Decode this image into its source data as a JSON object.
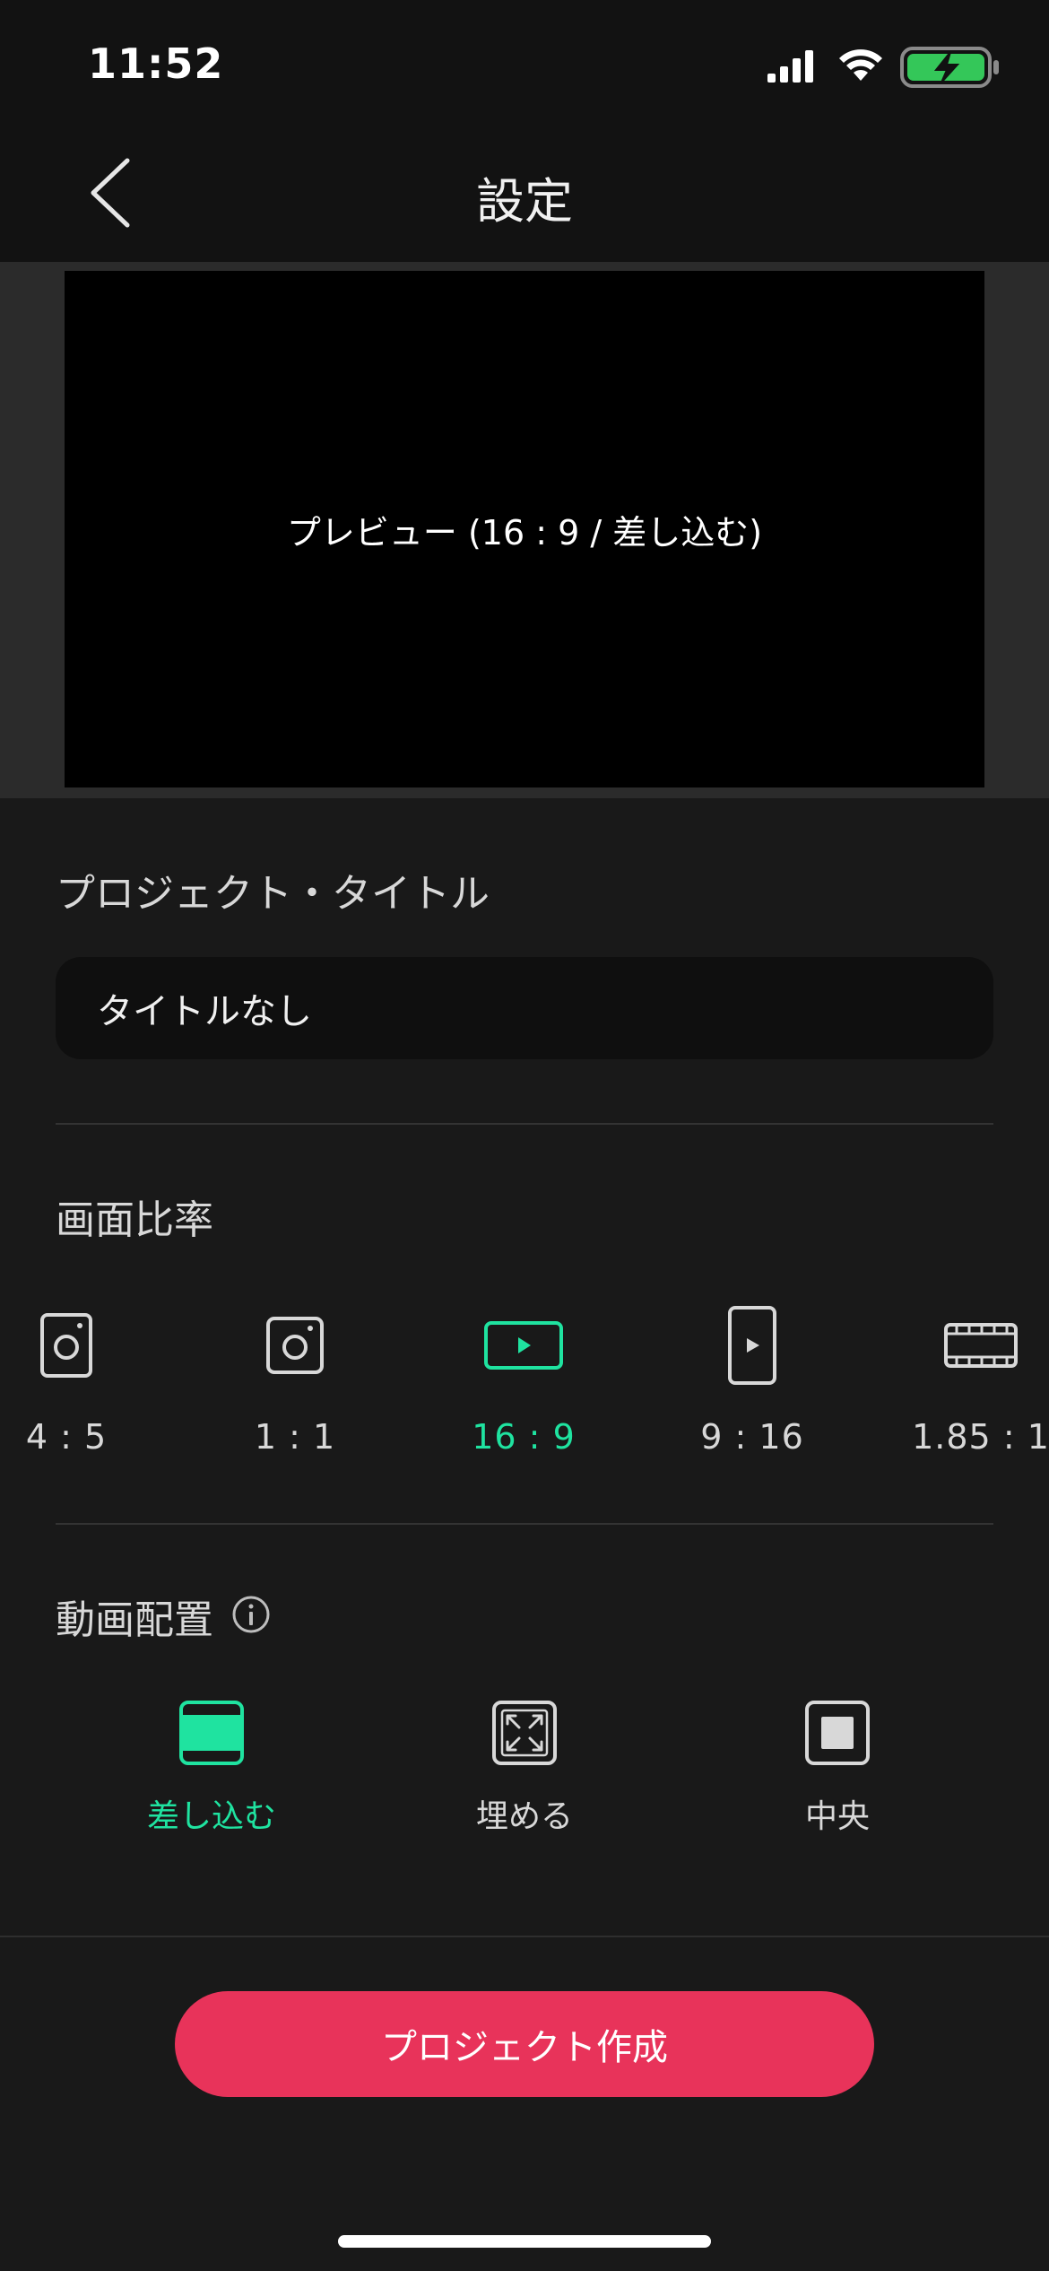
{
  "status_bar": {
    "time": "11:52"
  },
  "nav": {
    "title": "設定"
  },
  "preview": {
    "label": "プレビュー (16 : 9 / 差し込む)"
  },
  "project_title": {
    "heading": "プロジェクト・タイトル",
    "input_value": "タイトルなし"
  },
  "aspect_ratio": {
    "heading": "画面比率",
    "options": [
      {
        "label": "4 : 5",
        "icon": "portrait-camera-icon"
      },
      {
        "label": "1 : 1",
        "icon": "square-camera-icon"
      },
      {
        "label": "16 : 9",
        "icon": "landscape-play-icon"
      },
      {
        "label": "9 : 16",
        "icon": "portrait-play-icon"
      },
      {
        "label": "1.85 : 1",
        "icon": "film-strip-icon"
      }
    ],
    "selected": "16 : 9"
  },
  "video_layout": {
    "heading": "動画配置",
    "options": [
      {
        "label": "差し込む",
        "icon": "letterbox-icon"
      },
      {
        "label": "埋める",
        "icon": "expand-arrows-icon"
      },
      {
        "label": "中央",
        "icon": "center-square-icon"
      }
    ],
    "selected": "差し込む"
  },
  "actions": {
    "create_label": "プロジェクト作成"
  },
  "colors": {
    "accent": "#1fe3a0",
    "primary_button": "#e8335a",
    "background": "#191919"
  }
}
